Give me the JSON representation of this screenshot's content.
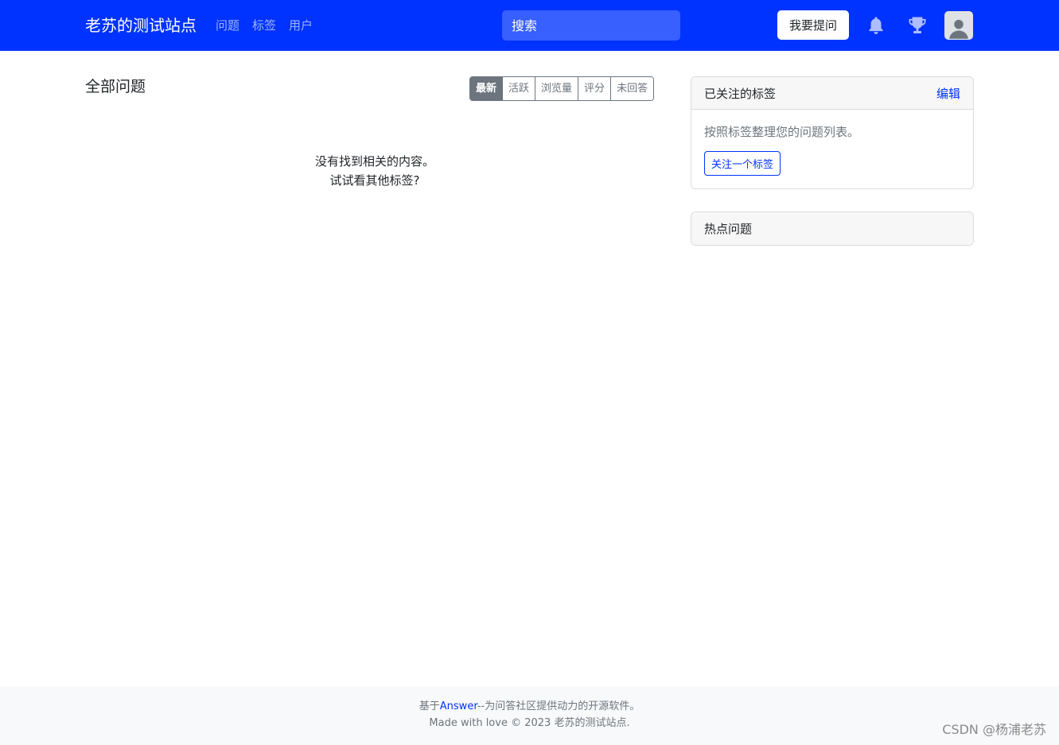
{
  "navbar": {
    "brand": "老苏的测试站点",
    "links": [
      "问题",
      "标签",
      "用户"
    ],
    "search_placeholder": "搜索",
    "ask_button": "我要提问",
    "icons": [
      "bell-icon",
      "trophy-icon",
      "user-avatar-icon"
    ],
    "bg_color": "#0033ff"
  },
  "main": {
    "title": "全部问题",
    "sort_tabs": [
      "最新",
      "活跃",
      "浏览量",
      "评分",
      "未回答"
    ],
    "active_sort": "最新",
    "empty_line1": "没有找到相关的内容。",
    "empty_line2": "试试看其他标签?"
  },
  "sidebar": {
    "followed_tags": {
      "title": "已关注的标签",
      "edit_label": "编辑",
      "description": "按照标签整理您的问题列表。",
      "follow_button": "关注一个标签"
    },
    "hot_questions": {
      "title": "热点问题"
    }
  },
  "footer": {
    "prefix": "基于",
    "link_text": "Answer",
    "suffix": "--为问答社区提供动力的开源软件。",
    "line2": "Made with love © 2023 老苏的测试站点."
  },
  "watermark": "CSDN @杨浦老苏"
}
